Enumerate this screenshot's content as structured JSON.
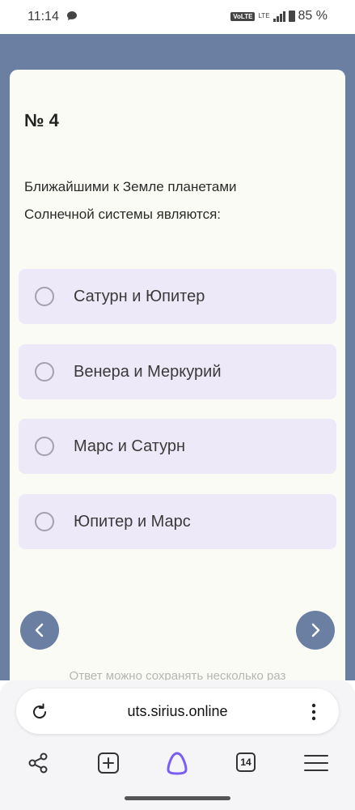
{
  "status_bar": {
    "time": "11:14",
    "volte": "VoLTE",
    "network": "LTE",
    "battery": "85 %"
  },
  "quiz": {
    "number": "№ 4",
    "question_line1": "Ближайшими к Земле планетами",
    "question_line2": "Солнечной системы являются:",
    "options": [
      {
        "label": "Сатурн и Юпитер"
      },
      {
        "label": "Венера и Меркурий"
      },
      {
        "label": "Марс и Сатурн"
      },
      {
        "label": "Юпитер и Марс"
      }
    ],
    "hint": "Ответ можно сохранять несколько раз"
  },
  "browser": {
    "url": "uts.sirius.online",
    "tab_count": "14"
  },
  "colors": {
    "backdrop": "#6a7fa2",
    "card": "#fbfbf6",
    "option_bg": "#ede9f8",
    "assistant_accent": "#7b5cf5"
  }
}
